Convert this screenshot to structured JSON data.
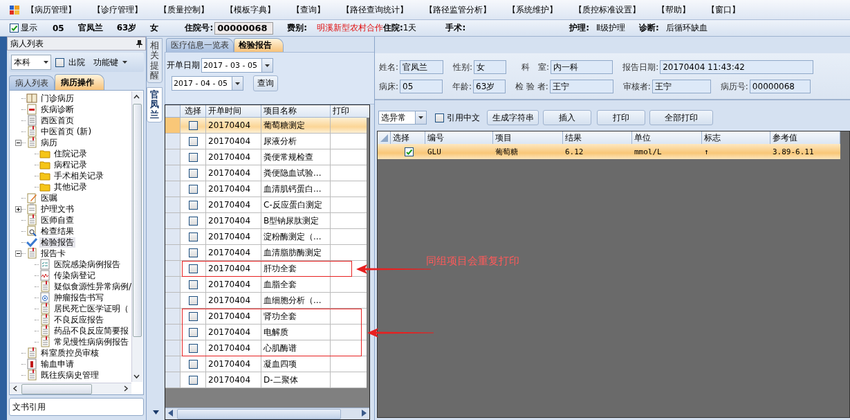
{
  "menu": [
    "【病历管理】",
    "【诊疗管理】",
    "【质量控制】",
    "【模板字典】",
    "【查询】",
    "【路径查询统计】",
    "【路径监管分析】",
    "【系统维护】",
    "【质控标准设置】",
    "【帮助】",
    "【窗口】"
  ],
  "patient_bar": {
    "show": {
      "label": "显示",
      "checked": true
    },
    "bed": "05",
    "name": "官凤兰",
    "age": "63岁",
    "sex": "女",
    "admission_label": "住院号:",
    "admission_no": "00000068",
    "fee_label": "费别:",
    "fee": "明溪新型农村合作",
    "stay_label": "住院:",
    "stay": "1天",
    "surgery_label": "手术:",
    "nursing_label": "护理:",
    "nursing": "Ⅱ级护理",
    "diagnosis_label": "诊断:",
    "diagnosis": "后循环缺血"
  },
  "left_panel": {
    "title": "病人列表",
    "scope": "本科",
    "discharged": {
      "label": "出院",
      "checked": false
    },
    "function_key": "功能键",
    "tabs": [
      {
        "label": "病人列表",
        "selected": false
      },
      {
        "label": "病历操作",
        "selected": true
      }
    ],
    "tree": [
      {
        "label": "门诊病历",
        "kind": "book",
        "selected": false
      },
      {
        "label": "疾病诊断",
        "kind": "card",
        "selected": false
      },
      {
        "label": "西医首页",
        "kind": "page",
        "selected": false
      },
      {
        "label": "中医首页 (新)",
        "kind": "doc",
        "selected": false
      },
      {
        "label": "病历",
        "kind": "doc",
        "selected": false,
        "expanded": true,
        "children": [
          {
            "label": "住院记录",
            "kind": "folder",
            "selected": false
          },
          {
            "label": "病程记录",
            "kind": "folder",
            "selected": false
          },
          {
            "label": "手术相关记录",
            "kind": "folder",
            "selected": false
          },
          {
            "label": "其他记录",
            "kind": "folder",
            "selected": false
          }
        ]
      },
      {
        "label": "医嘱",
        "kind": "pen",
        "selected": false
      },
      {
        "label": "护理文书",
        "kind": "clip",
        "selected": false,
        "expanded": false
      },
      {
        "label": "医师自查",
        "kind": "doc",
        "selected": false
      },
      {
        "label": "检查结果",
        "kind": "search",
        "selected": false
      },
      {
        "label": "检验报告",
        "kind": "tick",
        "selected": true
      },
      {
        "label": "报告卡",
        "kind": "doc",
        "selected": false,
        "expanded": true,
        "children": [
          {
            "label": "医院感染病例报告",
            "kind": "list",
            "selected": false
          },
          {
            "label": "传染病登记",
            "kind": "wave",
            "selected": false
          },
          {
            "label": "疑似食源性异常病例/",
            "kind": "doc",
            "selected": false
          },
          {
            "label": "肿瘤报告书写",
            "kind": "target",
            "selected": false
          },
          {
            "label": "居民死亡医学证明（",
            "kind": "doc",
            "selected": false
          },
          {
            "label": "不良反应报告",
            "kind": "doc",
            "selected": false
          },
          {
            "label": "药品不良反应简要报",
            "kind": "doc",
            "selected": false
          },
          {
            "label": "常见慢性病病例报告",
            "kind": "doc",
            "selected": false
          }
        ]
      },
      {
        "label": "科室质控员审核",
        "kind": "doc",
        "selected": false
      },
      {
        "label": "输血申请",
        "kind": "blood",
        "selected": false
      },
      {
        "label": "既往疾病史管理",
        "kind": "doc",
        "selected": false
      }
    ],
    "footer": "文书引用"
  },
  "side_tabs": [
    {
      "label": "相关提醒",
      "selected": false
    },
    {
      "label": "官凤兰",
      "selected": true
    }
  ],
  "middle": {
    "tabs": [
      {
        "label": "医疗信息一览表",
        "selected": false
      },
      {
        "label": "检验报告",
        "selected": true
      }
    ],
    "filter": {
      "label": "开单日期",
      "from": "2017 - 03 - 05",
      "to": "2017 - 04 - 05",
      "query": "查询"
    },
    "columns": [
      "选择",
      "开单时间",
      "项目名称",
      "打印"
    ],
    "rows": [
      {
        "date": "20170404",
        "item": "葡萄糖测定",
        "checked": false,
        "selected": true,
        "callout": false
      },
      {
        "date": "20170404",
        "item": "尿液分析",
        "checked": false,
        "selected": false,
        "callout": false
      },
      {
        "date": "20170404",
        "item": "粪便常规检查",
        "checked": false,
        "selected": false,
        "callout": false
      },
      {
        "date": "20170404",
        "item": "粪便隐血试验...",
        "checked": false,
        "selected": false,
        "callout": false
      },
      {
        "date": "20170404",
        "item": "血清肌钙蛋白...",
        "checked": false,
        "selected": false,
        "callout": false
      },
      {
        "date": "20170404",
        "item": "C-反应蛋白测定",
        "checked": false,
        "selected": false,
        "callout": false
      },
      {
        "date": "20170404",
        "item": "B型钠尿肽测定",
        "checked": false,
        "selected": false,
        "callout": false
      },
      {
        "date": "20170404",
        "item": "淀粉酶测定（...",
        "checked": false,
        "selected": false,
        "callout": false
      },
      {
        "date": "20170404",
        "item": "血清脂肪酶测定",
        "checked": false,
        "selected": false,
        "callout": false
      },
      {
        "date": "20170404",
        "item": "肝功全套",
        "checked": false,
        "selected": false,
        "callout": true
      },
      {
        "date": "20170404",
        "item": "血脂全套",
        "checked": false,
        "selected": false,
        "callout": false
      },
      {
        "date": "20170404",
        "item": "血细胞分析（...",
        "checked": false,
        "selected": false,
        "callout": false
      },
      {
        "date": "20170404",
        "item": "肾功全套",
        "checked": false,
        "selected": false,
        "callout": true
      },
      {
        "date": "20170404",
        "item": "电解质",
        "checked": false,
        "selected": false,
        "callout": true
      },
      {
        "date": "20170404",
        "item": "心肌酶谱",
        "checked": false,
        "selected": false,
        "callout": true
      },
      {
        "date": "20170404",
        "item": "凝血四项",
        "checked": false,
        "selected": false,
        "callout": false
      },
      {
        "date": "20170404",
        "item": "D-二聚体",
        "checked": false,
        "selected": false,
        "callout": false
      }
    ],
    "note": "同组项目会重复打印"
  },
  "report": {
    "info_rows": [
      {
        "fields": [
          {
            "label": "姓名:",
            "value": "官凤兰"
          },
          {
            "label": "性别:",
            "value": "女"
          },
          {
            "label": "科　室:",
            "value": "内一科"
          },
          {
            "label": "报告日期:",
            "value": "20170404 11:43:42"
          }
        ]
      },
      {
        "fields": [
          {
            "label": "病床:",
            "value": "05"
          },
          {
            "label": "年龄:",
            "value": "63岁"
          },
          {
            "label": "检 验 者:",
            "value": "王宁"
          },
          {
            "label": "审核者:",
            "value": "王宁"
          },
          {
            "label": "病历号:",
            "value": "00000068"
          }
        ]
      }
    ],
    "filter": "选异常",
    "use_chinese": {
      "label": "引用中文",
      "checked": false
    },
    "buttons": [
      "生成字符串",
      "插入",
      "打印",
      "全部打印"
    ],
    "columns": [
      "选择",
      "编号",
      "项目",
      "结果",
      "单位",
      "标志",
      "参考值"
    ],
    "rows": [
      {
        "checked": true,
        "selected": true,
        "code": "GLU",
        "item": "葡萄糖",
        "result": "6.12",
        "unit": "mmol/L",
        "flag": "↑",
        "range": "3.89-6.11"
      }
    ]
  }
}
